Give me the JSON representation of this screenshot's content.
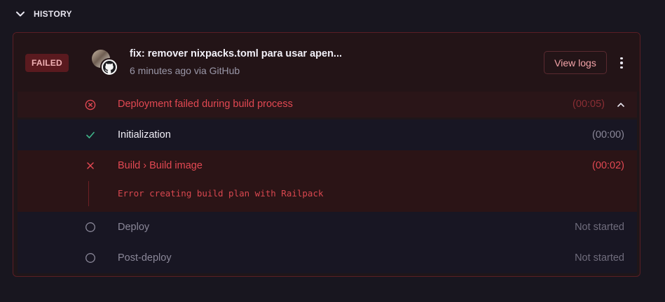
{
  "history": {
    "title": "HISTORY"
  },
  "deployment": {
    "status_badge": "FAILED",
    "commit_title": "fix: remover nixpacks.toml para usar apen...",
    "meta": "6 minutes ago via GitHub",
    "view_logs_label": "View logs"
  },
  "summary": {
    "label": "Deployment failed during build process",
    "time": "(00:05)"
  },
  "steps": [
    {
      "label": "Initialization",
      "time": "(00:00)",
      "status": "success"
    },
    {
      "label": "Build › Build image",
      "time": "(00:02)",
      "status": "failed",
      "error": "Error creating build plan with Railpack"
    },
    {
      "label": "Deploy",
      "time": "Not started",
      "status": "pending"
    },
    {
      "label": "Post-deploy",
      "time": "Not started",
      "status": "pending"
    }
  ],
  "colors": {
    "background": "#18161f",
    "failed_accent": "#e24852",
    "success_accent": "#3fb68b",
    "card_border": "#5a1e25"
  },
  "icons": [
    "chevron-down-icon",
    "github-icon",
    "more-vertical-icon",
    "error-circle-icon",
    "chevron-up-icon",
    "check-icon",
    "x-icon",
    "pending-circle-icon"
  ]
}
